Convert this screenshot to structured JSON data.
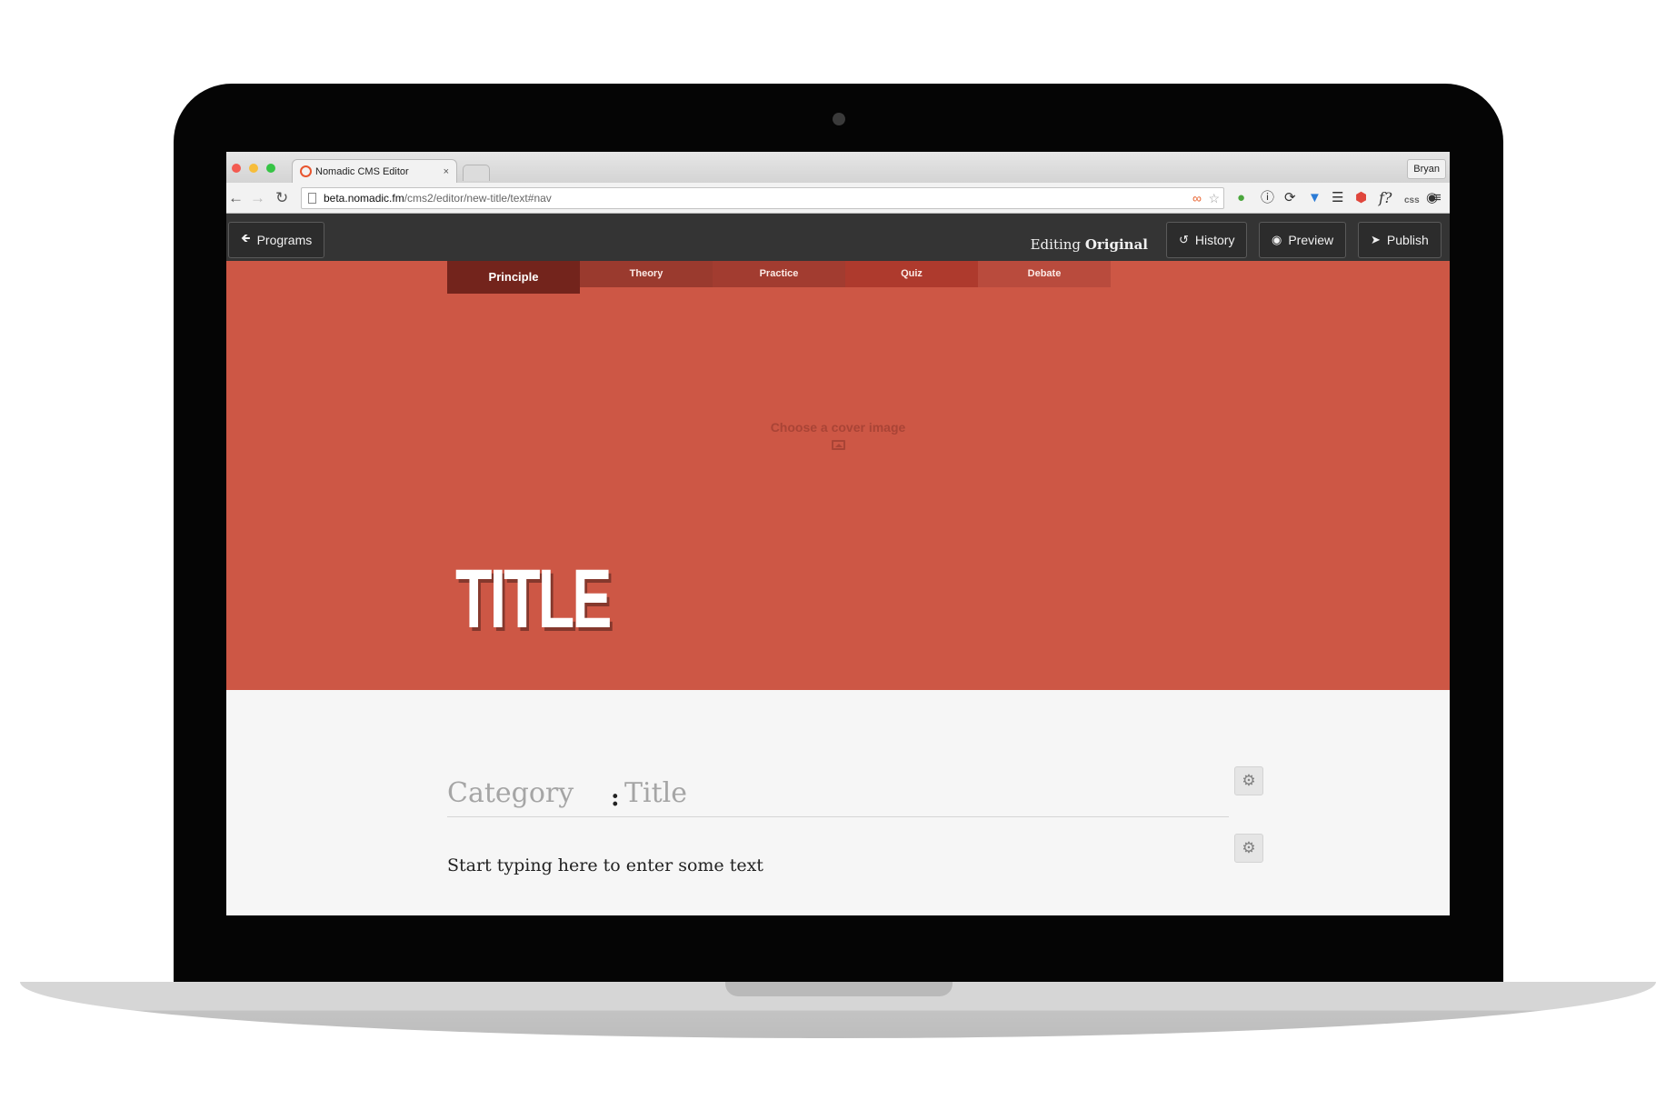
{
  "browser": {
    "tab_title": "Nomadic CMS Editor",
    "tab_close": "×",
    "profile": "Bryan",
    "url_host": "beta.nomadic.fm",
    "url_path": "/cms2/editor/new-title/text#nav",
    "extension_css": "css",
    "extension_f": "f?"
  },
  "header": {
    "programs_label": "Programs",
    "editing_prefix": "Editing ",
    "editing_value": "Original",
    "history_label": "History",
    "preview_label": "Preview",
    "publish_label": "Publish"
  },
  "tabs": [
    {
      "label": "Principle",
      "color": "#73241c",
      "active": true
    },
    {
      "label": "Theory",
      "color": "#9a3a2e",
      "active": false
    },
    {
      "label": "Practice",
      "color": "#a23c30",
      "active": false
    },
    {
      "label": "Quiz",
      "color": "#ae3a2d",
      "active": false
    },
    {
      "label": "Debate",
      "color": "#b94b3d",
      "active": false
    }
  ],
  "hero": {
    "cover_prompt": "Choose a cover image",
    "title": "TITLE",
    "background": "#cd5745"
  },
  "content": {
    "category_placeholder": "Category",
    "separator": ":",
    "title_placeholder": "Title",
    "body_placeholder": "Start typing here to enter some text"
  },
  "icons": {
    "back": "arrow-left-icon",
    "forward": "arrow-right-icon",
    "reload": "reload-icon",
    "history": "history-icon",
    "preview": "eye-icon",
    "publish": "paper-plane-icon",
    "settings": "gear-icon",
    "cover": "image-icon"
  }
}
